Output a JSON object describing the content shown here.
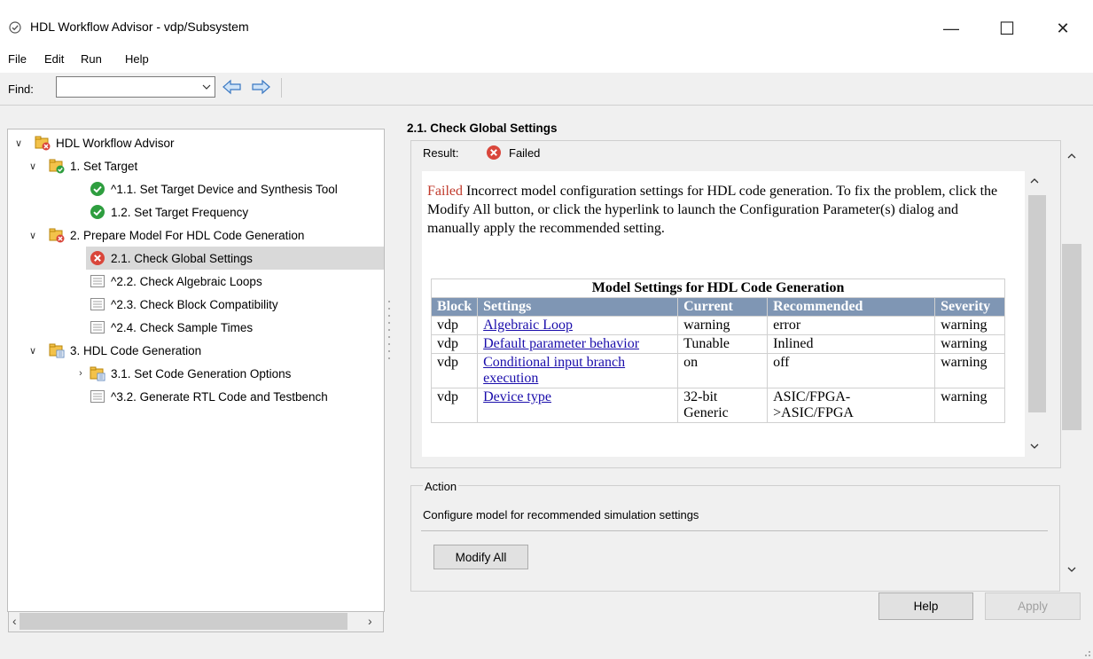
{
  "window": {
    "title": "HDL Workflow Advisor - vdp/Subsystem",
    "minimize": "—",
    "maximize": "☐",
    "close": "✕"
  },
  "menu": [
    "File",
    "Edit",
    "Run",
    "Help"
  ],
  "find": {
    "label": "Find:",
    "value": "",
    "dropdown_icon": "chevron-down-icon"
  },
  "tree": {
    "root": "HDL Workflow Advisor",
    "items": [
      {
        "label": "1. Set Target",
        "status": "passed-folder"
      },
      {
        "label": "^1.1. Set Target Device and Synthesis Tool",
        "status": "passed"
      },
      {
        "label": "1.2. Set Target Frequency",
        "status": "passed"
      },
      {
        "label": "2. Prepare Model For HDL Code Generation",
        "status": "failed-folder"
      },
      {
        "label": "2.1. Check Global Settings",
        "status": "failed",
        "selected": true
      },
      {
        "label": "^2.2. Check Algebraic Loops",
        "status": "not-run"
      },
      {
        "label": "^2.3. Check Block Compatibility",
        "status": "not-run"
      },
      {
        "label": "^2.4. Check Sample Times",
        "status": "not-run"
      },
      {
        "label": "3. HDL Code Generation",
        "status": "folder"
      },
      {
        "label": "3.1. Set Code Generation Options",
        "status": "folder"
      },
      {
        "label": "^3.2. Generate RTL Code and Testbench",
        "status": "not-run"
      }
    ]
  },
  "detail": {
    "heading": "2.1. Check Global Settings",
    "result_label": "Result:",
    "result_value": "Failed",
    "message_failed_word": "Failed",
    "message": " Incorrect model configuration settings for HDL code generation. To fix the problem, click the Modify All button, or click the hyperlink to launch the Configuration Parameter(s) dialog and manually apply the recommended setting.",
    "table": {
      "caption": "Model Settings for HDL Code Generation",
      "headers": [
        "Block",
        "Settings",
        "Current",
        "Recommended",
        "Severity"
      ],
      "rows": [
        [
          "vdp",
          "Algebraic Loop",
          "warning",
          "error",
          "warning"
        ],
        [
          "vdp",
          "Default parameter behavior",
          "Tunable",
          "Inlined",
          "warning"
        ],
        [
          "vdp",
          "Conditional input branch execution",
          "on",
          "off",
          "warning"
        ],
        [
          "vdp",
          "Device type",
          "32-bit Generic",
          "ASIC/FPGA->ASIC/FPGA",
          "warning"
        ]
      ]
    }
  },
  "action": {
    "title": "Action",
    "description": "Configure model for recommended simulation settings",
    "modify_all": "Modify All"
  },
  "buttons": {
    "help": "Help",
    "apply": "Apply"
  },
  "colors": {
    "failed": "#c0392b",
    "passed": "#2e9e3f",
    "table_header": "#7f96b4",
    "link": "#1a0dab"
  }
}
